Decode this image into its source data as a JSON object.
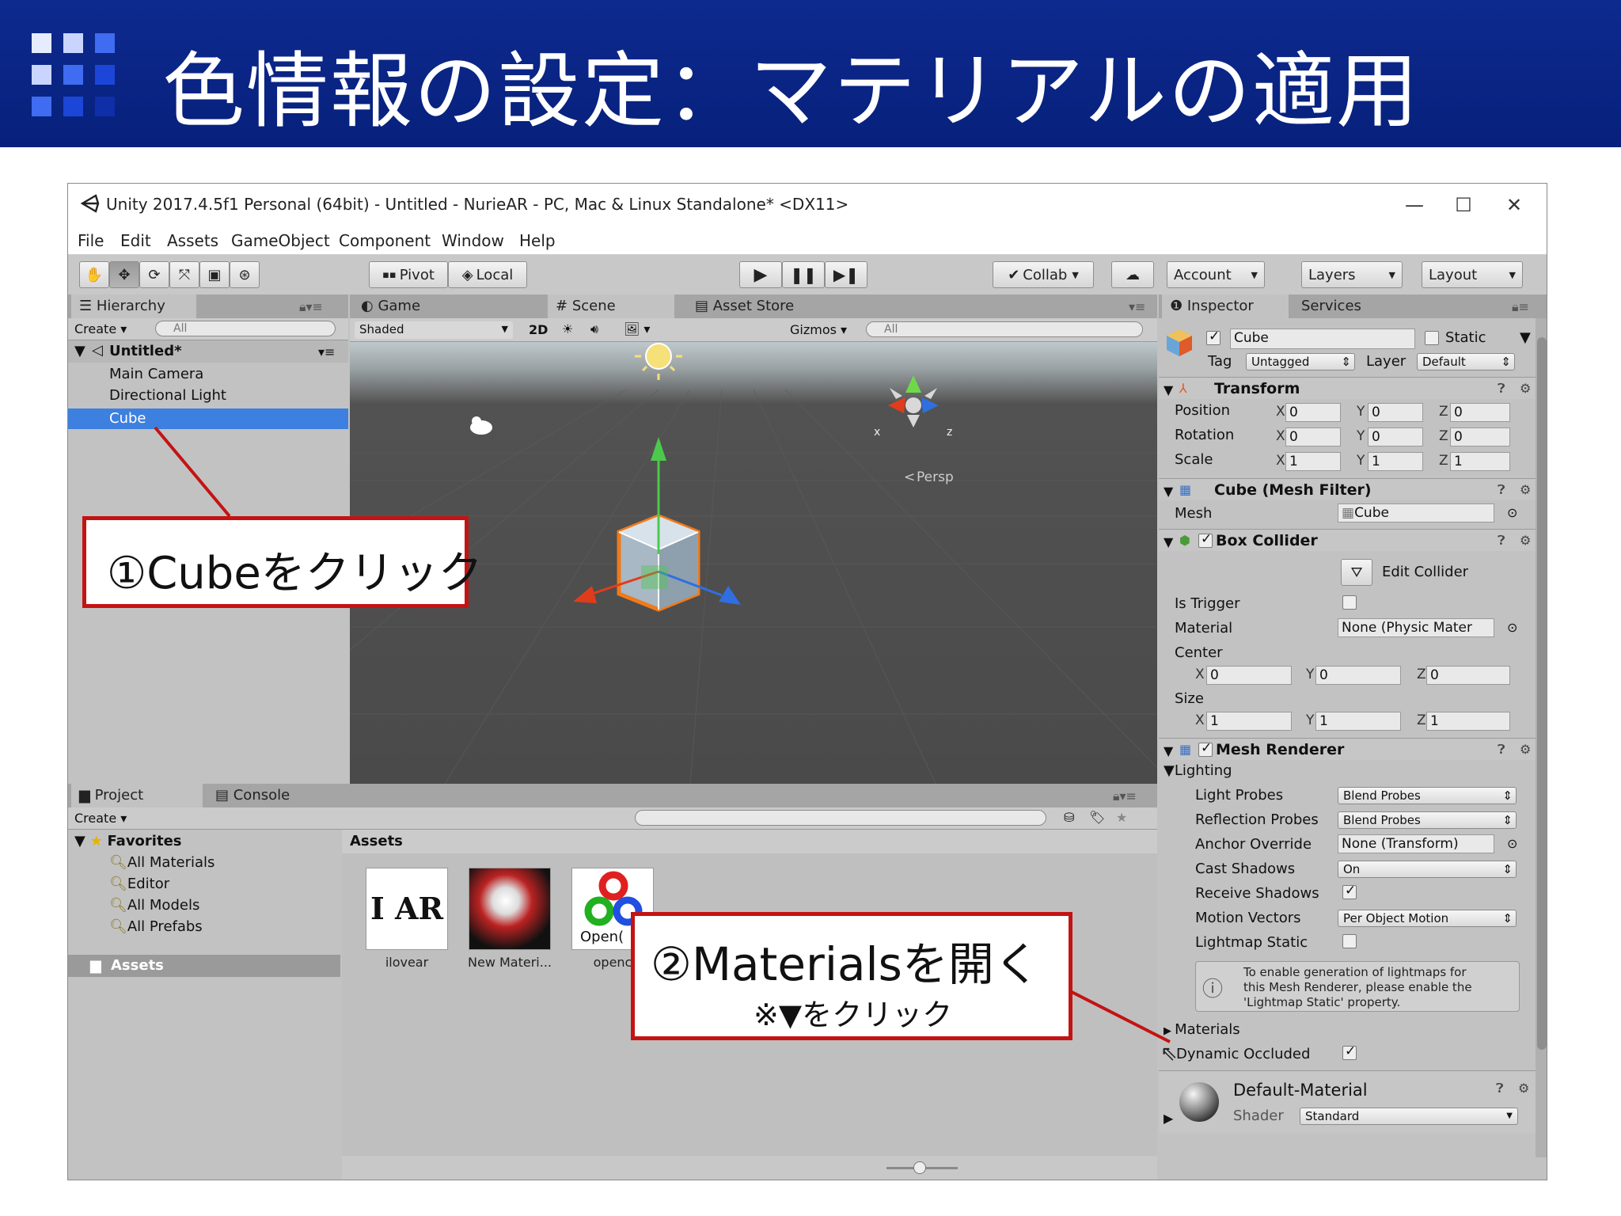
{
  "slide": {
    "title": "色情報の設定：マテリアルの適用"
  },
  "window": {
    "title": "Unity 2017.4.5f1 Personal (64bit) - Untitled - NurieAR - PC, Mac & Linux Standalone* <DX11>",
    "controls": {
      "minimize": "—",
      "maximize": "☐",
      "close": "✕"
    }
  },
  "menubar": [
    "File",
    "Edit",
    "Assets",
    "GameObject",
    "Component",
    "Window",
    "Help"
  ],
  "toolbar": {
    "pivot": "Pivot",
    "local": "Local",
    "collab": "Collab",
    "account": "Account",
    "layers": "Layers",
    "layout": "Layout"
  },
  "hierarchy": {
    "tab": "Hierarchy",
    "create": "Create",
    "search_placeholder": "All",
    "scene_name": "Untitled*",
    "items": [
      "Main Camera",
      "Directional Light",
      "Cube"
    ],
    "selected": "Cube"
  },
  "scene_view": {
    "tabs": [
      "Game",
      "Scene",
      "Asset Store"
    ],
    "active_tab": "Scene",
    "shading": "Shaded",
    "mode_2d": "2D",
    "gizmos": "Gizmos",
    "search_placeholder": "All",
    "persp_label": "Persp",
    "axis_x": "x",
    "axis_z": "z"
  },
  "inspector": {
    "tabs": [
      "Inspector",
      "Services"
    ],
    "object_name": "Cube",
    "static_label": "Static",
    "tag_label": "Tag",
    "tag_value": "Untagged",
    "layer_label": "Layer",
    "layer_value": "Default",
    "transform": {
      "title": "Transform",
      "rows": [
        {
          "label": "Position",
          "x": "0",
          "y": "0",
          "z": "0"
        },
        {
          "label": "Rotation",
          "x": "0",
          "y": "0",
          "z": "0"
        },
        {
          "label": "Scale",
          "x": "1",
          "y": "1",
          "z": "1"
        }
      ]
    },
    "mesh_filter": {
      "title": "Cube (Mesh Filter)",
      "mesh_label": "Mesh",
      "mesh_value": "Cube"
    },
    "box_collider": {
      "title": "Box Collider",
      "edit_collider": "Edit Collider",
      "is_trigger": "Is Trigger",
      "material_label": "Material",
      "material_value": "None (Physic Mater",
      "center_label": "Center",
      "center": {
        "x": "0",
        "y": "0",
        "z": "0"
      },
      "size_label": "Size",
      "size": {
        "x": "1",
        "y": "1",
        "z": "1"
      }
    },
    "mesh_renderer": {
      "title": "Mesh Renderer",
      "lighting": "Lighting",
      "light_probes_label": "Light Probes",
      "light_probes_value": "Blend Probes",
      "reflection_probes_label": "Reflection Probes",
      "reflection_probes_value": "Blend Probes",
      "anchor_override_label": "Anchor Override",
      "anchor_override_value": "None (Transform)",
      "cast_shadows_label": "Cast Shadows",
      "cast_shadows_value": "On",
      "receive_shadows_label": "Receive Shadows",
      "motion_vectors_label": "Motion Vectors",
      "motion_vectors_value": "Per Object Motion",
      "lightmap_static_label": "Lightmap Static",
      "info_line1": "To enable generation of lightmaps for",
      "info_line2": "this Mesh Renderer, please enable the",
      "info_line3": "'Lightmap Static' property.",
      "materials_label": "Materials",
      "dynamic_occluded_label": "Dynamic Occluded"
    },
    "material": {
      "name": "Default-Material",
      "shader_label": "Shader",
      "shader_value": "Standard"
    }
  },
  "project": {
    "tabs": [
      "Project",
      "Console"
    ],
    "create": "Create",
    "favorites": "Favorites",
    "favorites_items": [
      "All Materials",
      "Editor",
      "All Models",
      "All Prefabs"
    ],
    "assets_root": "Assets",
    "assets_header": "Assets",
    "assets": [
      {
        "name": "ilovear",
        "thumb_text": "I AR"
      },
      {
        "name": "New Materi...",
        "thumb_text": ""
      },
      {
        "name": "openc",
        "thumb_text": "Open("
      }
    ]
  },
  "callouts": {
    "cube_click": "①Cubeをクリック",
    "materials_open": "②Materialsを開く",
    "materials_note": "※▼をクリック"
  },
  "colors": {
    "slide_header": "#0a268a",
    "callout_border": "#c41313",
    "selection": "#3d80df",
    "unity_gray": "#c2c2c2"
  }
}
